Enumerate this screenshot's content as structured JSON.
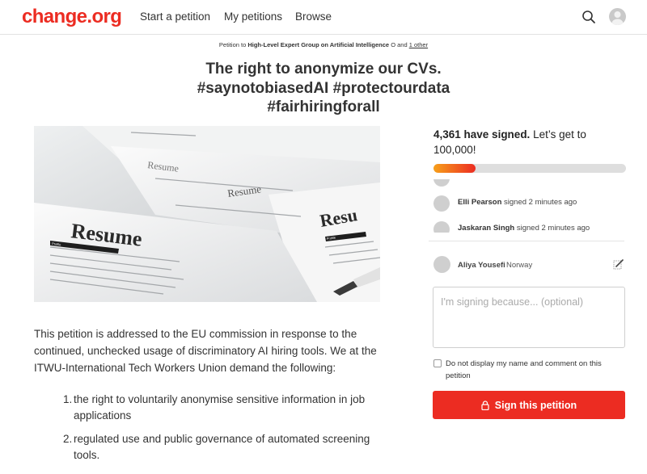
{
  "header": {
    "logo": "change.org",
    "nav": [
      "Start a petition",
      "My petitions",
      "Browse"
    ],
    "search_icon": "search-icon",
    "avatar_icon": "user-avatar-icon"
  },
  "petition": {
    "to_prefix": "Petition to",
    "recipient": "High-Level Expert Group on Artificial Intelligence",
    "recipient_suffix": "O",
    "and_text": "and",
    "other_link": "1 other",
    "title_lines": [
      "The right to anonymize our CVs.",
      "#saynotobiasedAI #protectourdata",
      "#fairhiringforall"
    ],
    "hero_labels": [
      "Resume",
      "Resume",
      "Resume",
      "Resu",
      "Profile",
      "Profile"
    ],
    "body": "This petition is addressed to the EU commission in response to the continued, unchecked usage of discriminatory AI hiring tools. We at the ITWU-International Tech Workers Union demand the following:",
    "demands": [
      {
        "num": "1.",
        "text": "the right to voluntarily anonymise sensitive information in job applications"
      },
      {
        "num": "2.",
        "text": "regulated use and public governance of automated screening tools."
      }
    ]
  },
  "sidebar": {
    "signed_count": "4,361 have signed.",
    "goal_text": "Let’s get to 100,000!",
    "progress": 0.22,
    "feed": [
      {
        "name": "Elli Pearson",
        "action": "signed 2 minutes ago"
      },
      {
        "name": "Jaskaran Singh",
        "action": "signed 2 minutes ago"
      }
    ],
    "user": {
      "name": "Aliya Yousefi",
      "country": "Norway"
    },
    "comment_placeholder": "I'm signing because... (optional)",
    "checkbox_label": "Do not display my name and comment on this petition",
    "sign_button": "Sign this petition"
  },
  "colors": {
    "brand": "#ec2c22",
    "progress_start": "#f7a01a"
  }
}
